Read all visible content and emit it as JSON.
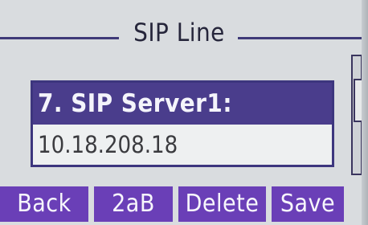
{
  "screen": {
    "title": "SIP Line",
    "setting": {
      "label": "7. SIP Server1:",
      "value": "10.18.208.18"
    },
    "softkeys": [
      {
        "label": "Back"
      },
      {
        "label": "2aB"
      },
      {
        "label": "Delete"
      },
      {
        "label": "Save"
      }
    ],
    "scroll_position": 0.3
  },
  "colors": {
    "background": "#d9dcdf",
    "accent": "#4a3d8c",
    "softkey": "#6a3fb7",
    "text": "#26263b"
  }
}
